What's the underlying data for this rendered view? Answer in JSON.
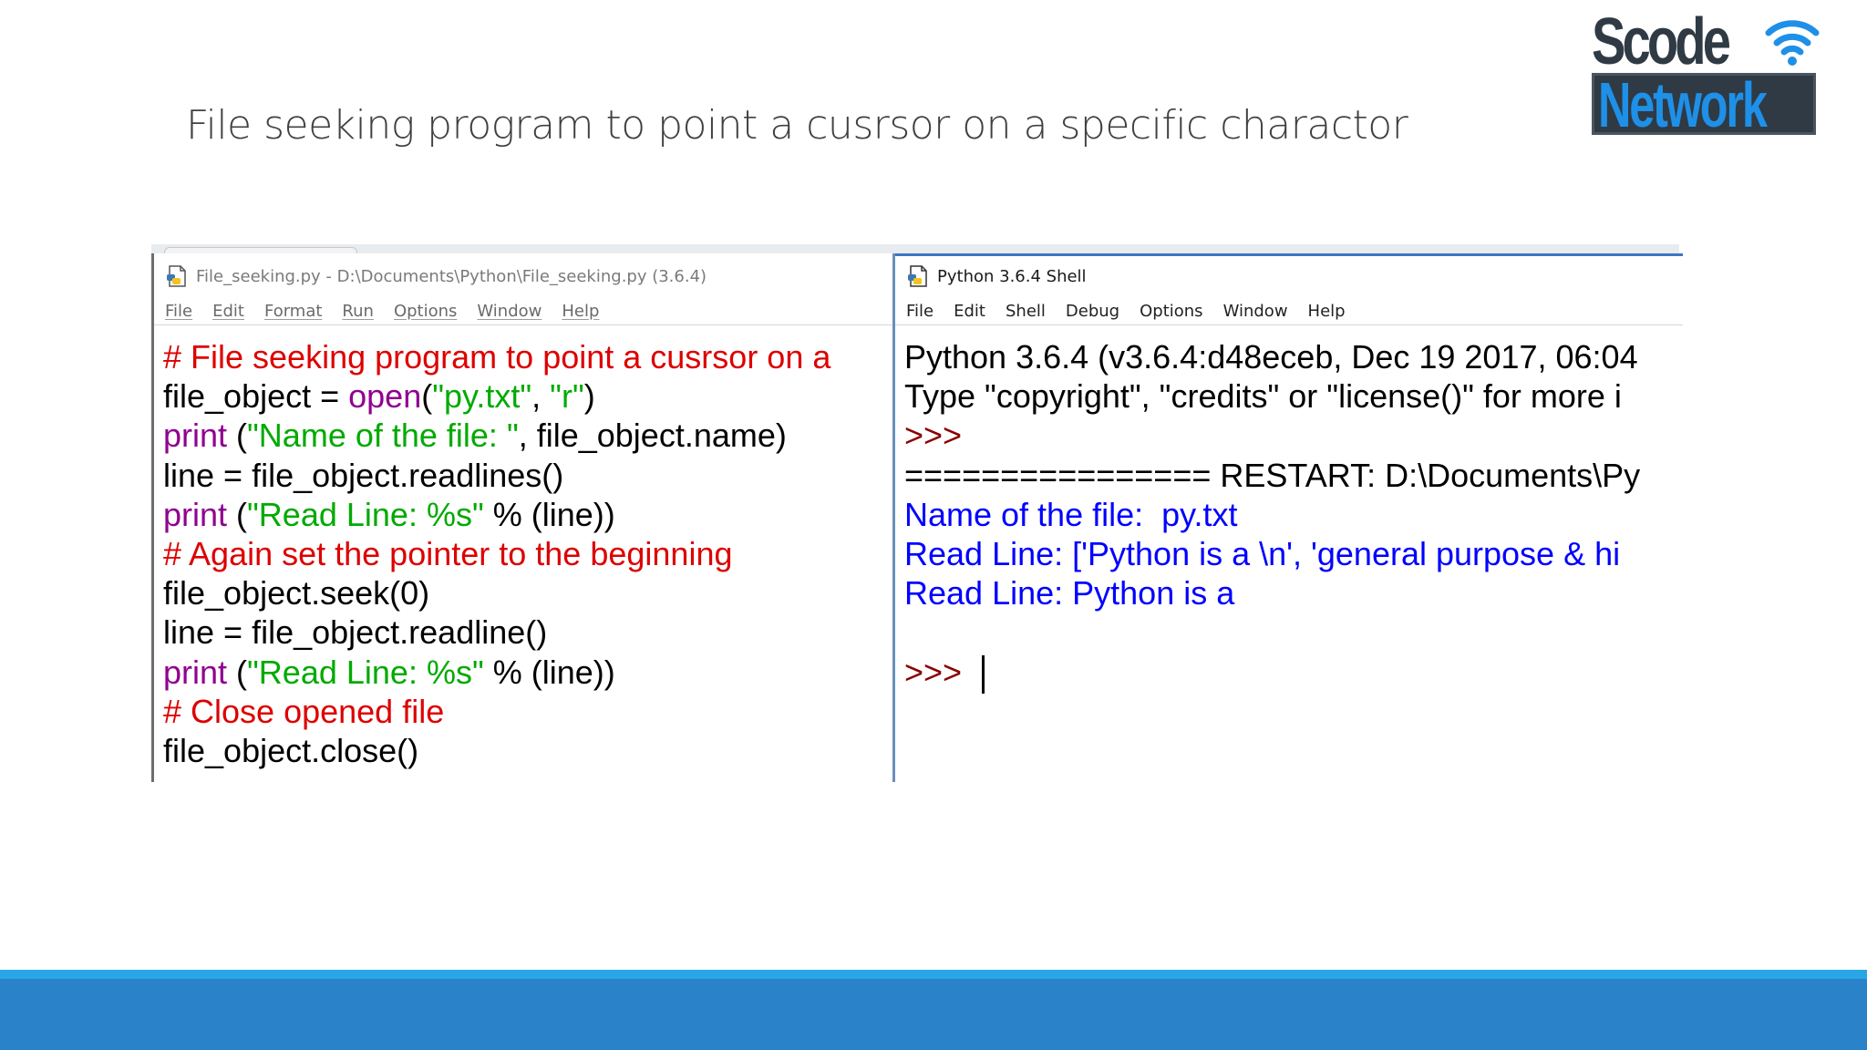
{
  "slide": {
    "title": "File seeking program to point a cusrsor on a specific charactor",
    "logo": {
      "line1": "Scode",
      "line2": "Network",
      "icon": "wifi-icon"
    }
  },
  "editor": {
    "icon": "python-file-icon",
    "title": "File_seeking.py - D:\\Documents\\Python\\File_seeking.py (3.6.4)",
    "menu": [
      "File",
      "Edit",
      "Format",
      "Run",
      "Options",
      "Window",
      "Help"
    ],
    "code": [
      [
        {
          "t": "# File seeking program to point a cusrsor on a",
          "c": "comment"
        }
      ],
      [
        {
          "t": "file_object = ",
          "c": "plain"
        },
        {
          "t": "open",
          "c": "builtin"
        },
        {
          "t": "(",
          "c": "plain"
        },
        {
          "t": "\"py.txt\"",
          "c": "str"
        },
        {
          "t": ", ",
          "c": "plain"
        },
        {
          "t": "\"r\"",
          "c": "str"
        },
        {
          "t": ")",
          "c": "plain"
        }
      ],
      [
        {
          "t": "print",
          "c": "builtin"
        },
        {
          "t": " (",
          "c": "plain"
        },
        {
          "t": "\"Name of the file: \"",
          "c": "str"
        },
        {
          "t": ", file_object.name)",
          "c": "plain"
        }
      ],
      [
        {
          "t": "line = file_object.readlines()",
          "c": "plain"
        }
      ],
      [
        {
          "t": "print",
          "c": "builtin"
        },
        {
          "t": " (",
          "c": "plain"
        },
        {
          "t": "\"Read Line: %s\"",
          "c": "str"
        },
        {
          "t": " % (line))",
          "c": "plain"
        }
      ],
      [
        {
          "t": "# Again set the pointer to the beginning",
          "c": "comment"
        }
      ],
      [
        {
          "t": "file_object.seek(0)",
          "c": "plain"
        }
      ],
      [
        {
          "t": "line = file_object.readline()",
          "c": "plain"
        }
      ],
      [
        {
          "t": "print",
          "c": "builtin"
        },
        {
          "t": " (",
          "c": "plain"
        },
        {
          "t": "\"Read Line: %s\"",
          "c": "str"
        },
        {
          "t": " % (line))",
          "c": "plain"
        }
      ],
      [
        {
          "t": "# Close opened file",
          "c": "comment"
        }
      ],
      [
        {
          "t": "file_object.close()",
          "c": "plain"
        }
      ]
    ]
  },
  "shell": {
    "icon": "python-shell-icon",
    "title": "Python 3.6.4 Shell",
    "menu": [
      "File",
      "Edit",
      "Shell",
      "Debug",
      "Options",
      "Window",
      "Help"
    ],
    "lines": [
      [
        {
          "t": "Python 3.6.4 (v3.6.4:d48eceb, Dec 19 2017, 06:04",
          "c": "plain"
        }
      ],
      [
        {
          "t": "Type \"copyright\", \"credits\" or \"license()\" for more i",
          "c": "plain"
        }
      ],
      [
        {
          "t": ">>> ",
          "c": "prompt"
        }
      ],
      [
        {
          "t": "================ RESTART: D:\\Documents\\Py",
          "c": "plain"
        }
      ],
      [
        {
          "t": "Name of the file:  py.txt",
          "c": "out"
        }
      ],
      [
        {
          "t": "Read Line: ['Python is a \\n', 'general purpose & hi",
          "c": "out"
        }
      ],
      [
        {
          "t": "Read Line: Python is a",
          "c": "out"
        }
      ],
      [
        {
          "t": "",
          "c": "plain"
        }
      ],
      [
        {
          "t": ">>> ",
          "c": "prompt"
        }
      ]
    ]
  },
  "colors": {
    "comment": "#dd0000",
    "builtin": "#900090",
    "string": "#00aa00",
    "output": "#0000ff",
    "prompt": "#8b0000",
    "footer_light": "#29a6e6",
    "footer_dark": "#2a82c8"
  }
}
